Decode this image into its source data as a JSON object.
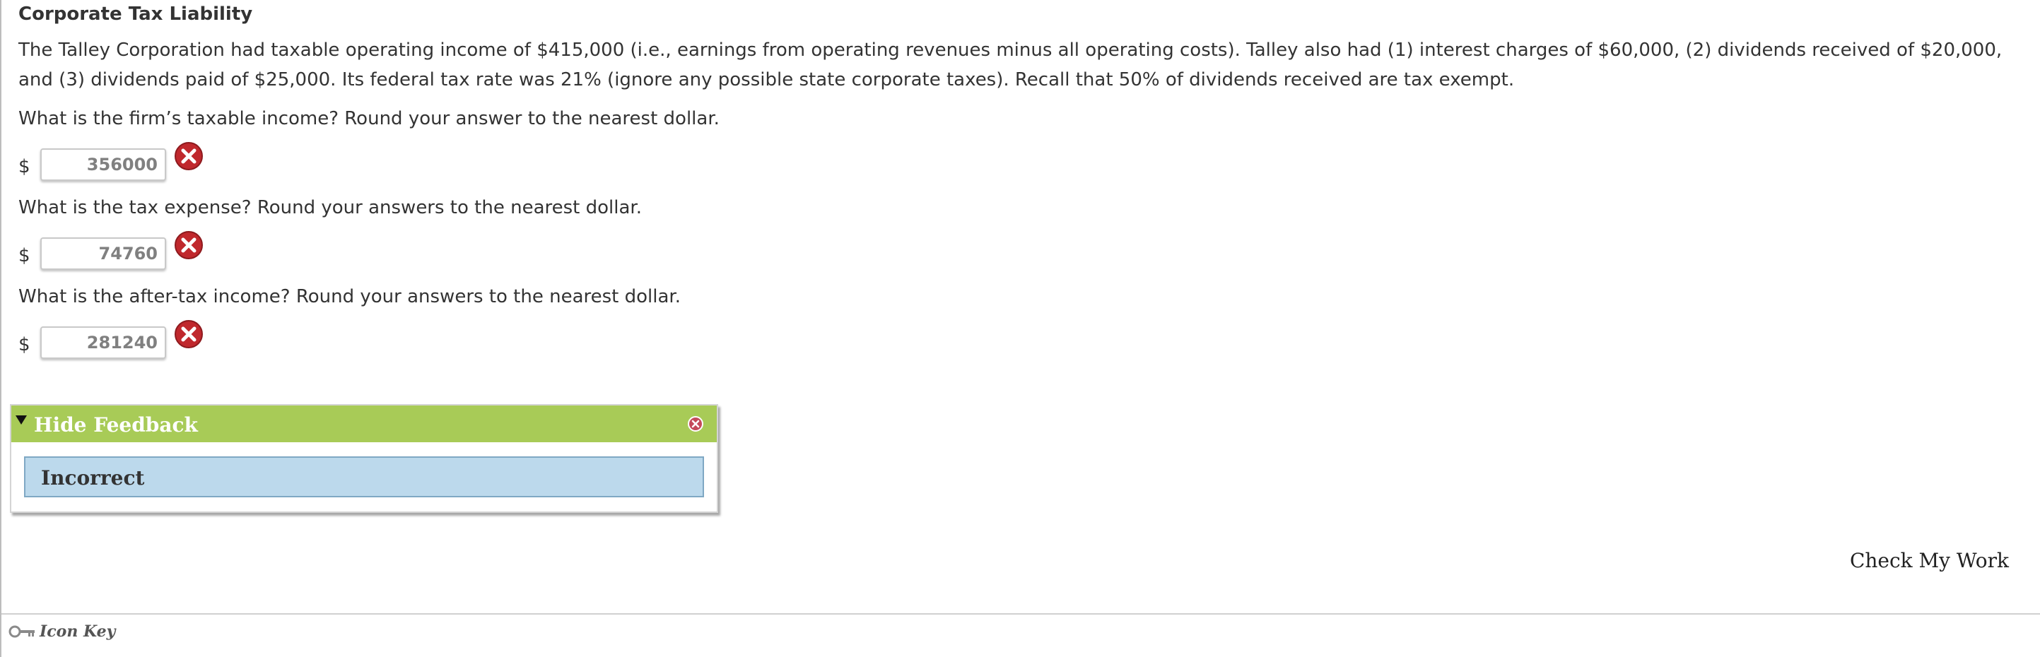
{
  "title": "Corporate Tax Liability",
  "problem_text": "The Talley Corporation had taxable operating income of $415,000 (i.e., earnings from operating revenues minus all operating costs). Talley also had (1) interest charges of $60,000, (2) dividends received of $20,000, and (3) dividends paid of $25,000. Its federal tax rate was 21% (ignore any possible state corporate taxes). Recall that 50% of dividends received are tax exempt.",
  "questions": [
    {
      "text": "What is the firm’s taxable income? Round your answer to the nearest dollar.",
      "currency": "$",
      "value": "356000",
      "status_icon": "incorrect-x-icon"
    },
    {
      "text": "What is the tax expense? Round your answers to the nearest dollar.",
      "currency": "$",
      "value": "74760",
      "status_icon": "incorrect-x-icon"
    },
    {
      "text": "What is the after-tax income? Round your answers to the nearest dollar.",
      "currency": "$",
      "value": "281240",
      "status_icon": "incorrect-x-icon"
    }
  ],
  "feedback": {
    "header_label": "Hide Feedback",
    "result_label": "Incorrect",
    "header_color": "#a8cb57",
    "result_bg_color": "#bcd9ec"
  },
  "check_my_work_label": "Check My Work",
  "icon_key_label": "Icon Key",
  "colors": {
    "error_red": "#c0282d",
    "text": "#333333"
  }
}
